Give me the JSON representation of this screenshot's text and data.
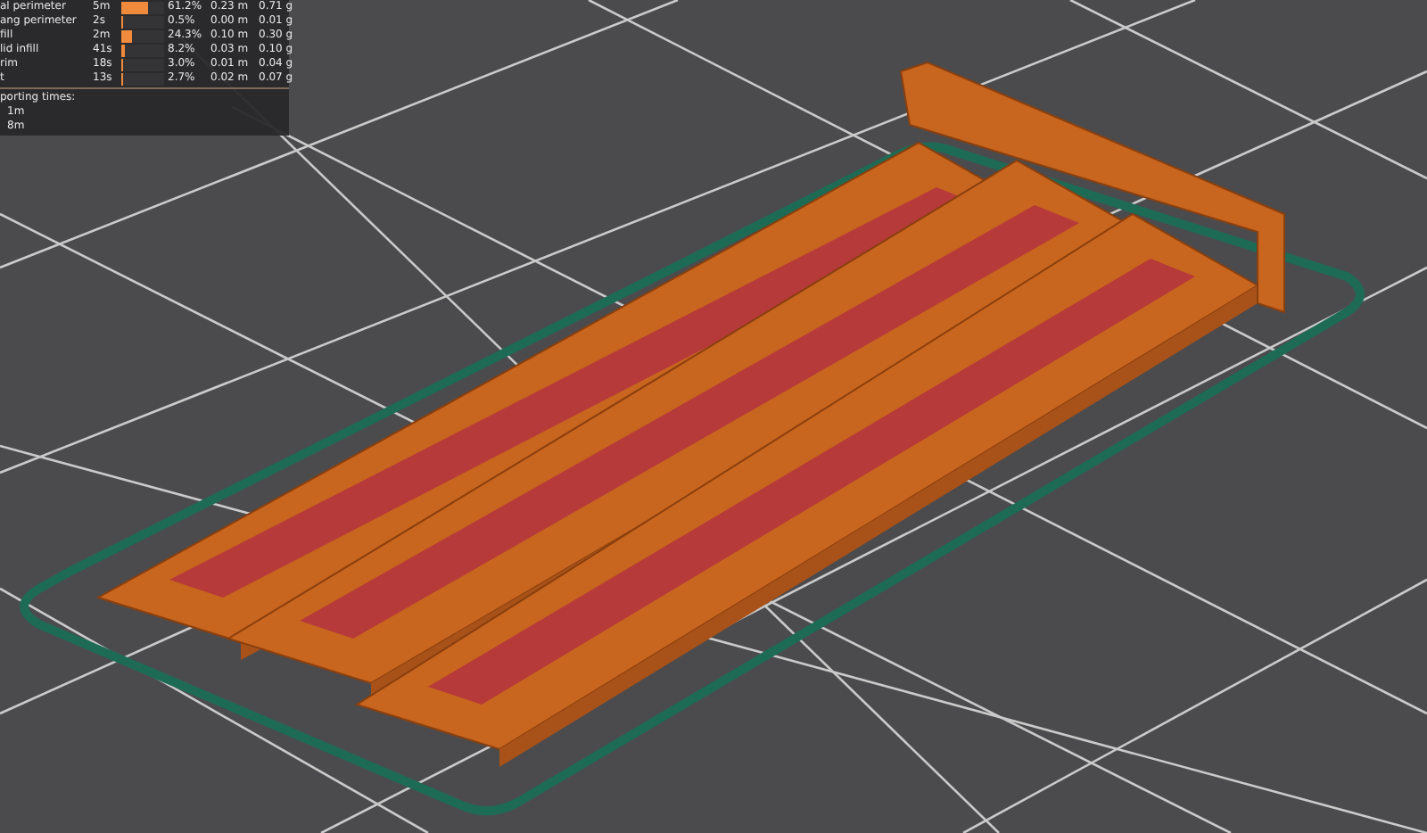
{
  "legend": {
    "rows": [
      {
        "label": "al perimeter",
        "time": "5m",
        "level": 0.612,
        "percent": "61.2%",
        "length": "0.23 m",
        "weight": "0.71 g"
      },
      {
        "label": "ang perimeter",
        "time": "2s",
        "level": 0.005,
        "percent": "0.5%",
        "length": "0.00 m",
        "weight": "0.01 g"
      },
      {
        "label": "fill",
        "time": "2m",
        "level": 0.243,
        "percent": "24.3%",
        "length": "0.10 m",
        "weight": "0.30 g"
      },
      {
        "label": "lid infill",
        "time": "41s",
        "level": 0.082,
        "percent": "8.2%",
        "length": "0.03 m",
        "weight": "0.10 g"
      },
      {
        "label": "rim",
        "time": "18s",
        "level": 0.03,
        "percent": "3.0%",
        "length": "0.01 m",
        "weight": "0.04 g"
      },
      {
        "label": "t",
        "time": "13s",
        "level": 0.027,
        "percent": "2.7%",
        "length": "0.02 m",
        "weight": "0.07 g"
      }
    ],
    "section_title": "porting times:",
    "times": [
      "1m",
      "8m"
    ]
  }
}
